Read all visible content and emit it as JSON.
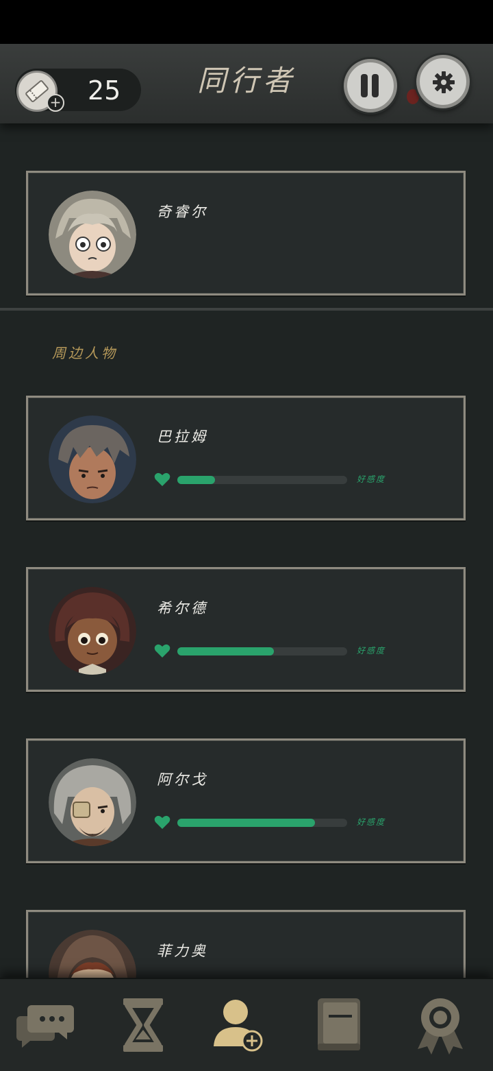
{
  "header": {
    "ticket_count": "25",
    "title": "同行者"
  },
  "companion": {
    "name": "奇睿尔"
  },
  "section_label": "周边人物",
  "nearby": [
    {
      "name": "巴拉姆",
      "affection": 0.22,
      "affection_label": "好感度"
    },
    {
      "name": "希尔德",
      "affection": 0.57,
      "affection_label": "好感度"
    },
    {
      "name": "阿尔戈",
      "affection": 0.81,
      "affection_label": "好感度"
    },
    {
      "name": "菲力奥"
    }
  ],
  "colors": {
    "affection_bar": "#2aa36c",
    "section_label": "#b79a5a",
    "card_border": "#8f8b80"
  },
  "icons": {
    "nav": [
      "chat-icon",
      "hourglass-icon",
      "companions-icon",
      "journal-icon",
      "achievement-icon"
    ]
  }
}
